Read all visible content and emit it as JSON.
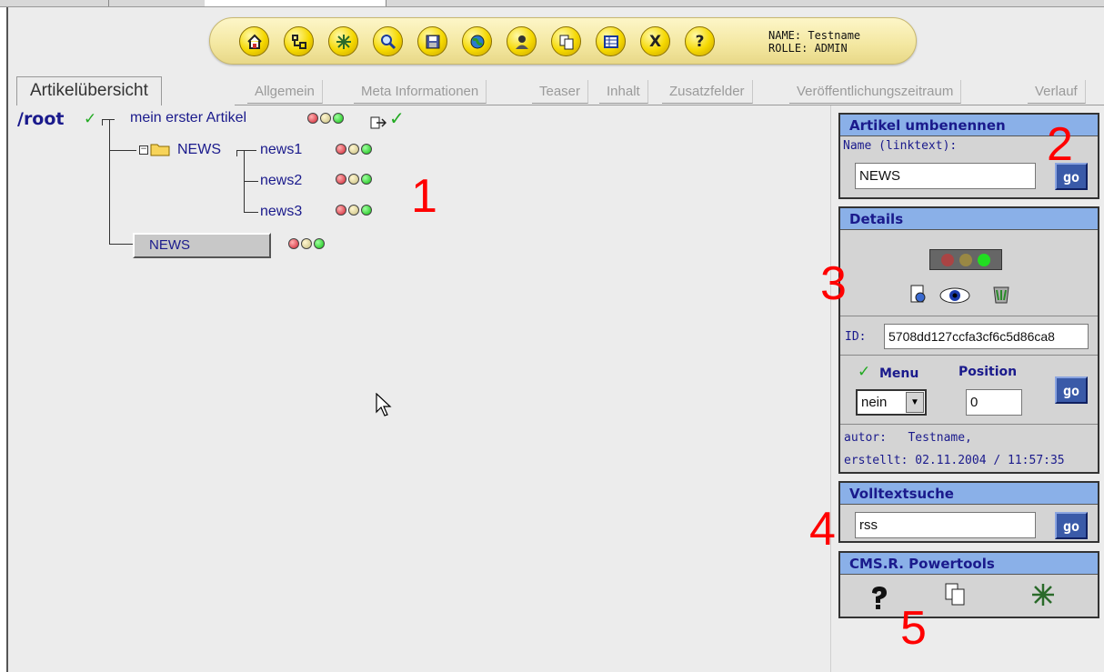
{
  "toolbar": {
    "buttons": [
      {
        "name": "home",
        "glyph": "⌂"
      },
      {
        "name": "tree",
        "glyph": "⊞"
      },
      {
        "name": "sitemap",
        "glyph": "✲"
      },
      {
        "name": "search",
        "glyph": "⚲"
      },
      {
        "name": "save",
        "glyph": "▣"
      },
      {
        "name": "globe",
        "glyph": "◉"
      },
      {
        "name": "user",
        "glyph": "☻"
      },
      {
        "name": "copy",
        "glyph": "❐"
      },
      {
        "name": "table",
        "glyph": "▤"
      },
      {
        "name": "close",
        "glyph": "X"
      },
      {
        "name": "help",
        "glyph": "?"
      }
    ],
    "user_name": "NAME: Testname",
    "user_role": "ROLLE: ADMIN"
  },
  "tabs": [
    {
      "label": "Artikelübersicht",
      "active": true
    },
    {
      "label": "Allgemein"
    },
    {
      "label": "Meta Informationen"
    },
    {
      "label": "Teaser"
    },
    {
      "label": "Inhalt"
    },
    {
      "label": "Zusatzfelder"
    },
    {
      "label": "Veröffentlichungszeitraum"
    },
    {
      "label": "Verlauf"
    }
  ],
  "tree": {
    "root": "/root",
    "first_article": "mein erster Artikel",
    "folder": "NEWS",
    "items": [
      "news1",
      "news2",
      "news3"
    ],
    "rename_node": "NEWS"
  },
  "annotations": [
    "1",
    "2",
    "3",
    "4",
    "5"
  ],
  "rename": {
    "title": "Artikel umbenennen",
    "field_label": "Name (linktext):",
    "value": "NEWS",
    "go": "go"
  },
  "details": {
    "title": "Details",
    "id_label": "ID:",
    "id_value": "5708dd127ccfa3cf6c5d86ca8",
    "menu_label": "Menu",
    "position_label": "Position",
    "menu_value": "nein",
    "position_value": "0",
    "go": "go",
    "author": "autor:   Testname,",
    "created": "erstellt: 02.11.2004 / 11:57:35"
  },
  "search": {
    "title": "Volltextsuche",
    "value": "rss",
    "go": "go"
  },
  "powertools": {
    "title": "CMS.R. Powertools"
  },
  "colors": {
    "header_blue": "#8ab0e8",
    "text_navy": "#1a1a8c",
    "annotation_red": "#ff0000",
    "go_button": "#3a5aa8"
  }
}
